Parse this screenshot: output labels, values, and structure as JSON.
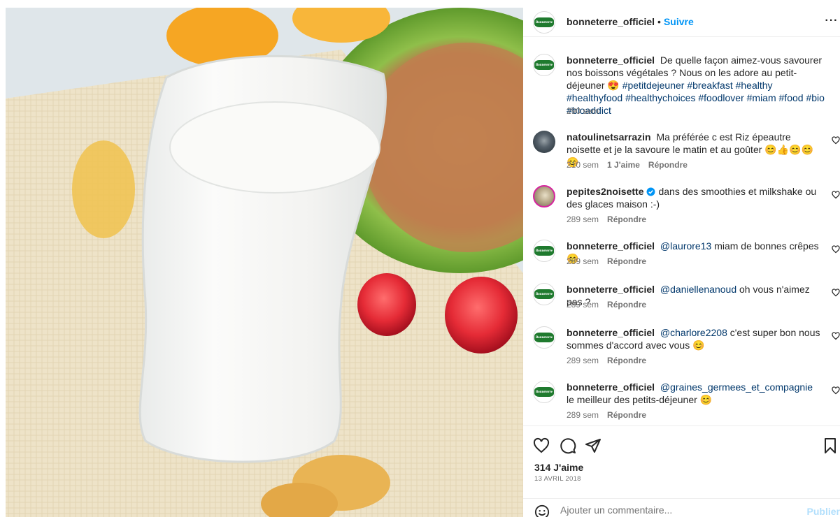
{
  "post": {
    "author": "bonneterre_officiel",
    "follow_label": "Suivre",
    "separator": "•",
    "more_label": "···",
    "logo_text": "Bonneterre",
    "caption": {
      "text": "De quelle façon aimez-vous savourer nos boissons végétales ? Nous on les adore au petit-déjeuner 😍",
      "hashtags": "#petitdejeuner #breakfast #healthy #healthyfood #healthychoices #foodlover #miam #food #bio #bioaddict",
      "time": "290 sem"
    }
  },
  "comments": [
    {
      "user": "natoulinetsarrazin",
      "text": "Ma préférée c est Riz épeautre noisette et je la savoure le matin et au goûter 😊👍😊😊😊",
      "time": "210 sem",
      "likes": "1 J'aime",
      "reply": "Répondre"
    },
    {
      "user": "pepites2noisette",
      "verified": true,
      "text": "dans des smoothies et milkshake ou des glaces maison :-)",
      "time": "289 sem",
      "reply": "Répondre"
    },
    {
      "user": "bonneterre_officiel",
      "mention": "@laurore13",
      "text": "miam de bonnes crêpes 😊",
      "time": "289 sem",
      "reply": "Répondre"
    },
    {
      "user": "bonneterre_officiel",
      "mention": "@daniellenanoud",
      "text": "oh vous n'aimez pas ?",
      "time": "289 sem",
      "reply": "Répondre"
    },
    {
      "user": "bonneterre_officiel",
      "mention": "@charlore2208",
      "text": "c'est super bon nous sommes d'accord avec vous 😊",
      "time": "289 sem",
      "reply": "Répondre"
    },
    {
      "user": "bonneterre_officiel",
      "mention": "@graines_germees_et_compagnie",
      "text": "le meilleur des petits-déjeuner 😊",
      "time": "289 sem",
      "reply": "Répondre"
    }
  ],
  "footer": {
    "likes": "314 J'aime",
    "date": "13 AVRIL 2018",
    "comment_placeholder": "Ajouter un commentaire...",
    "publish_label": "Publier"
  },
  "colors": {
    "accent": "#0095f6",
    "hashtag": "#00376b",
    "muted": "#737373",
    "brand_green": "#1f7a2e"
  }
}
